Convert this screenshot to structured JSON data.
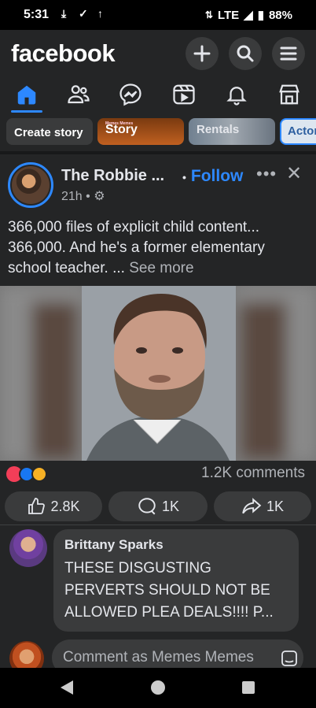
{
  "status_bar": {
    "time": "5:31",
    "network": "LTE",
    "battery": "88%"
  },
  "app": {
    "logo": "facebook"
  },
  "top_actions": [
    {
      "icon": "plus-icon"
    },
    {
      "icon": "search-icon"
    },
    {
      "icon": "menu-icon"
    }
  ],
  "nav_tabs": [
    {
      "icon": "home-icon",
      "active": true
    },
    {
      "icon": "friends-icon"
    },
    {
      "icon": "messenger-icon"
    },
    {
      "icon": "video-icon"
    },
    {
      "icon": "bell-icon"
    },
    {
      "icon": "marketplace-icon"
    }
  ],
  "stories": {
    "create_label": "Create story",
    "story_label": "Story",
    "story_tiny_text": "Memes Memes",
    "rentals_label": "Rentals",
    "actor_label": "Actor"
  },
  "post": {
    "author": "The Robbie ...",
    "follow_label": "Follow",
    "time": "21h",
    "text_line1": "366,000 files of explicit child content...",
    "text_line2": "366,000. And he's a former elementary",
    "text_line3": "school teacher. ...",
    "see_more": "See more",
    "comments_count": "1.2K comments",
    "like_count": "2.8K",
    "comment_btn_count": "1K",
    "share_count": "1K"
  },
  "comment": {
    "author": "Brittany Sparks",
    "line1": "THESE DISGUSTING",
    "line2": "PERVERTS SHOULD NOT BE",
    "line3": "ALLOWED PLEA DEALS!!!! P..."
  },
  "composer": {
    "placeholder": "Comment as Memes Memes"
  },
  "colors": {
    "accent": "#2d88ff",
    "background": "#242526",
    "surface": "#3a3b3c"
  }
}
